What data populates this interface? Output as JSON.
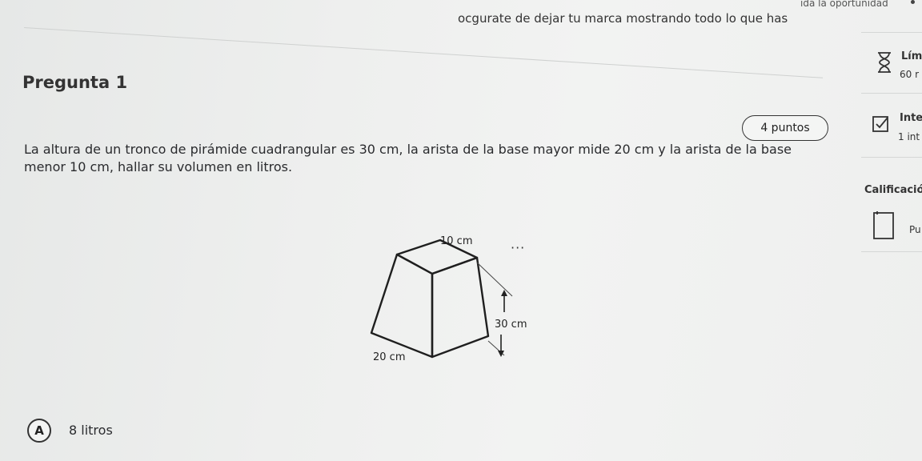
{
  "banner": {
    "line1": "ida la oportunidad",
    "line2": "ocgurate de dejar tu marca mostrando todo lo que has"
  },
  "question": {
    "title": "Pregunta 1",
    "points": "4 puntos",
    "text": "La altura de un tronco de pirámide cuadrangular es 30 cm, la arista de la base mayor mide 20 cm y la arista de la base menor 10 cm, hallar su volumen en litros.",
    "figure": {
      "top_label": "10 cm",
      "height_label": "30 cm",
      "base_label": "20 cm"
    },
    "more_icon": "···"
  },
  "options": [
    {
      "letter": "A",
      "text": "8 litros"
    }
  ],
  "sidebar": {
    "time": {
      "icon": "hourglass-icon",
      "title": "Lím",
      "value": "60 r"
    },
    "attempts": {
      "icon": "checkbox-icon",
      "title": "Inte",
      "value": "1 int"
    },
    "grading": {
      "title": "Calificació"
    },
    "score": {
      "icon": "square-icon",
      "title": "Pu"
    }
  }
}
